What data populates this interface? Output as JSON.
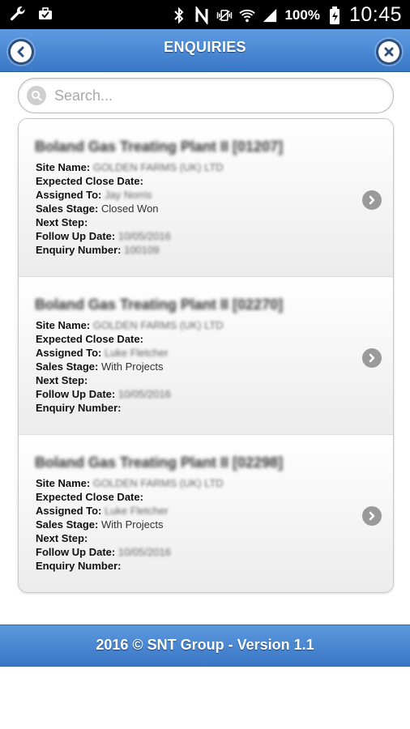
{
  "status_bar": {
    "battery": "100%",
    "time": "10:45",
    "icons": [
      "wrench-icon",
      "briefcase-icon",
      "bluetooth-icon",
      "nfc-icon",
      "vibrate-icon",
      "wifi-icon",
      "signal-icon",
      "battery-icon"
    ]
  },
  "header": {
    "title": "ENQUIRIES"
  },
  "search": {
    "placeholder": "Search..."
  },
  "labels": {
    "site_name": "Site Name:",
    "expected_close_date": "Expected Close Date:",
    "assigned_to": "Assigned To:",
    "sales_stage": "Sales Stage:",
    "next_step": "Next Step:",
    "follow_up_date": "Follow Up Date:",
    "enquiry_number": "Enquiry Number:"
  },
  "enquiries": [
    {
      "title": "Boland Gas Treating Plant II [01207]",
      "site_name": "GOLDEN FARMS (UK) LTD",
      "expected_close_date": "",
      "assigned_to": "Jay Norris",
      "sales_stage": "Closed Won",
      "next_step": "",
      "follow_up_date": "10/05/2016",
      "enquiry_number": "100109"
    },
    {
      "title": "Boland Gas Treating Plant II [02270]",
      "site_name": "GOLDEN FARMS (UK) LTD",
      "expected_close_date": "",
      "assigned_to": "Luke Fletcher",
      "sales_stage": "With Projects",
      "next_step": "",
      "follow_up_date": "10/05/2016",
      "enquiry_number": ""
    },
    {
      "title": "Boland Gas Treating Plant II [02298]",
      "site_name": "GOLDEN FARMS (UK) LTD",
      "expected_close_date": "",
      "assigned_to": "Luke Fletcher",
      "sales_stage": "With Projects",
      "next_step": "",
      "follow_up_date": "10/05/2016",
      "enquiry_number": ""
    }
  ],
  "footer": {
    "text": "2016 © SNT Group - Version 1.1"
  },
  "colors": {
    "header": "#4a88d4",
    "footer": "#4a88d4",
    "status_bar": "#000000"
  }
}
